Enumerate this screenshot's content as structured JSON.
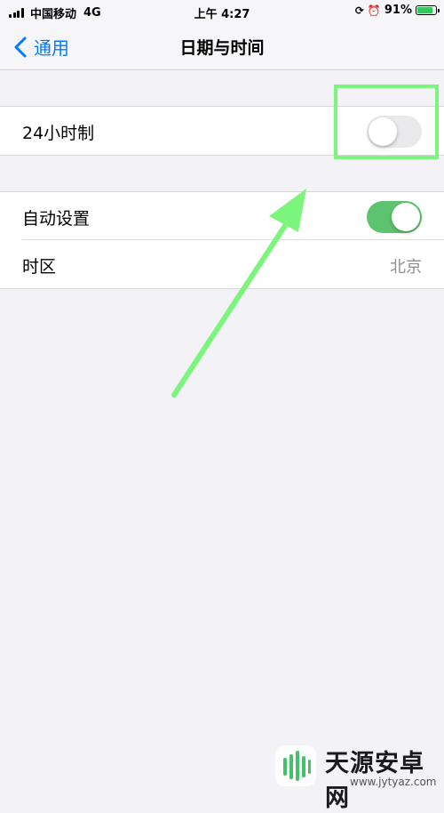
{
  "status_bar": {
    "carrier": "中国移动",
    "network": "4G",
    "time": "上午 4:27",
    "battery_percent": "91%",
    "icons": [
      "rotation-lock-icon",
      "alarm-icon",
      "battery-charging-icon"
    ]
  },
  "nav": {
    "back_label": "通用",
    "title": "日期与时间"
  },
  "settings": {
    "hour24": {
      "label": "24小时制",
      "enabled": false
    },
    "auto_set": {
      "label": "自动设置",
      "enabled": true
    },
    "timezone": {
      "label": "时区",
      "value": "北京"
    }
  },
  "colors": {
    "accent": "#007aff",
    "toggle_on": "#5ec36e",
    "annotation": "#7cf57c"
  },
  "watermark": {
    "name": "天源安卓网",
    "url": "www.jytyaz.com"
  }
}
